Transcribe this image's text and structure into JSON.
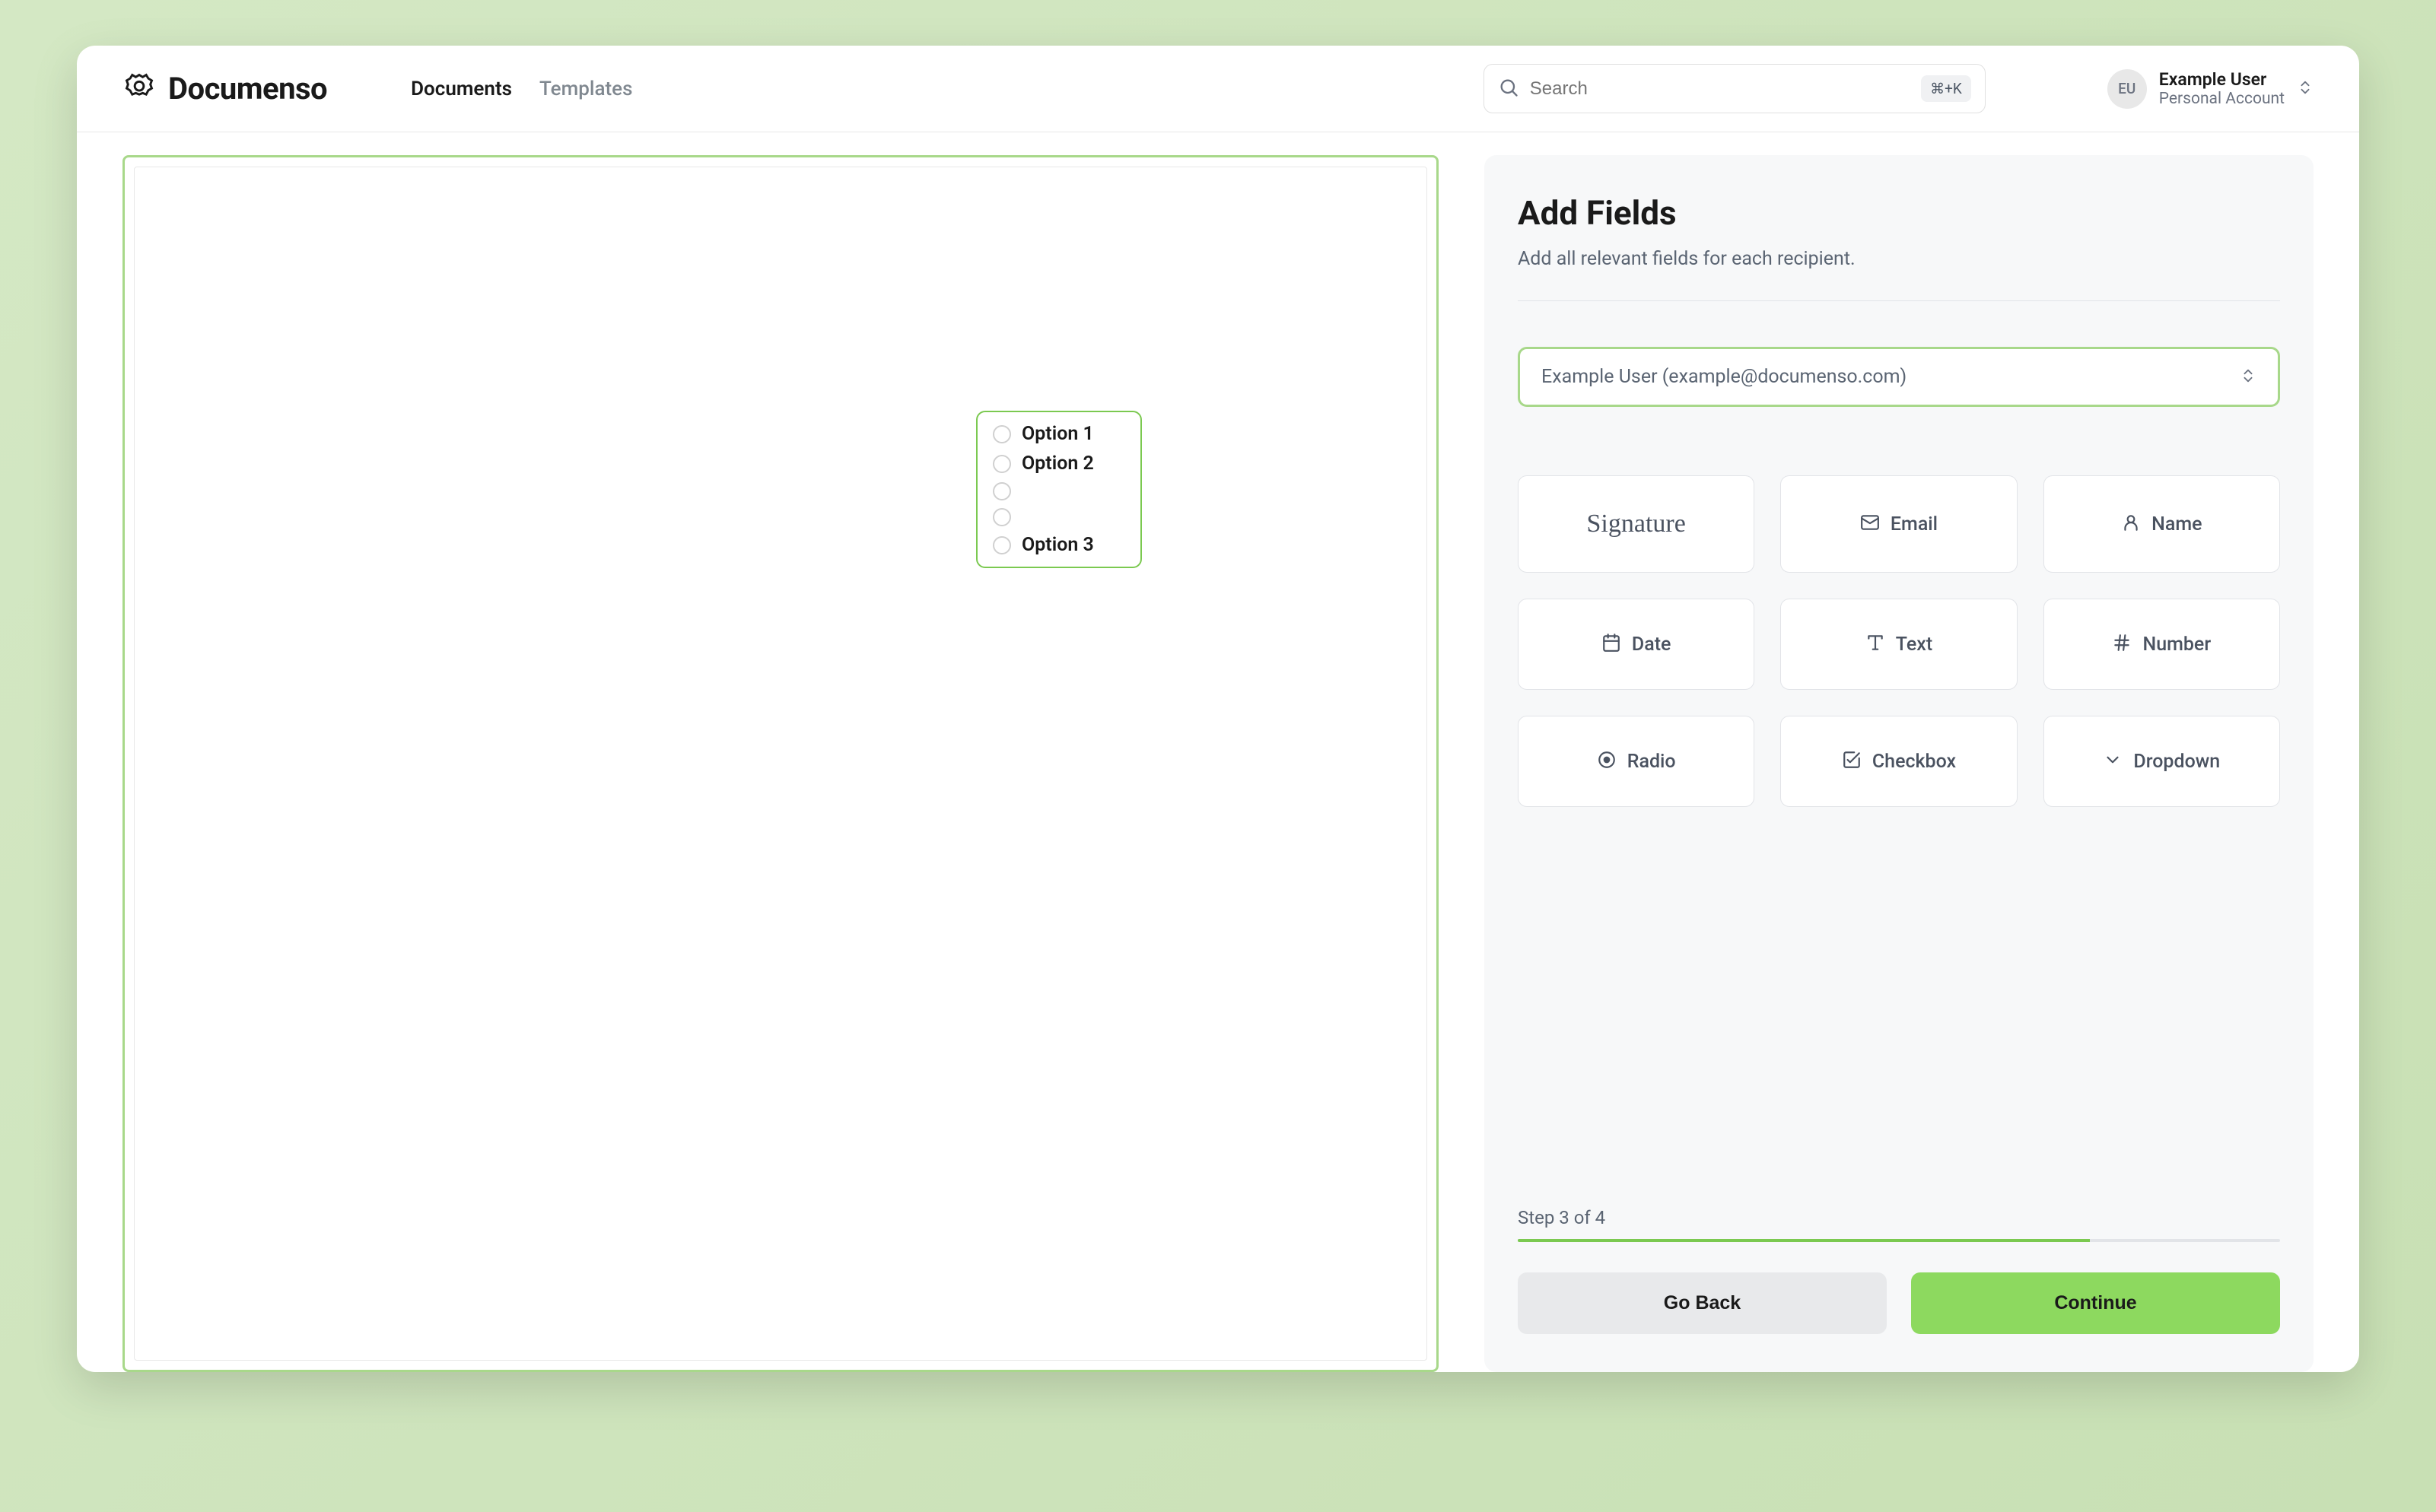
{
  "brand": "Documenso",
  "nav": {
    "documents": "Documents",
    "templates": "Templates"
  },
  "search": {
    "placeholder": "Search",
    "shortcut": "⌘+K"
  },
  "user": {
    "initials": "EU",
    "name": "Example User",
    "subtitle": "Personal Account"
  },
  "radio_options": [
    "Option 1",
    "Option 2",
    "",
    "",
    "Option 3"
  ],
  "panel": {
    "title": "Add Fields",
    "subtitle": "Add all relevant fields for each recipient.",
    "recipient": "Example User (example@documenso.com)",
    "fields": {
      "signature": "Signature",
      "email": "Email",
      "name": "Name",
      "date": "Date",
      "text": "Text",
      "number": "Number",
      "radio": "Radio",
      "checkbox": "Checkbox",
      "dropdown": "Dropdown"
    },
    "step": "Step 3 of 4",
    "go_back": "Go Back",
    "continue": "Continue"
  }
}
